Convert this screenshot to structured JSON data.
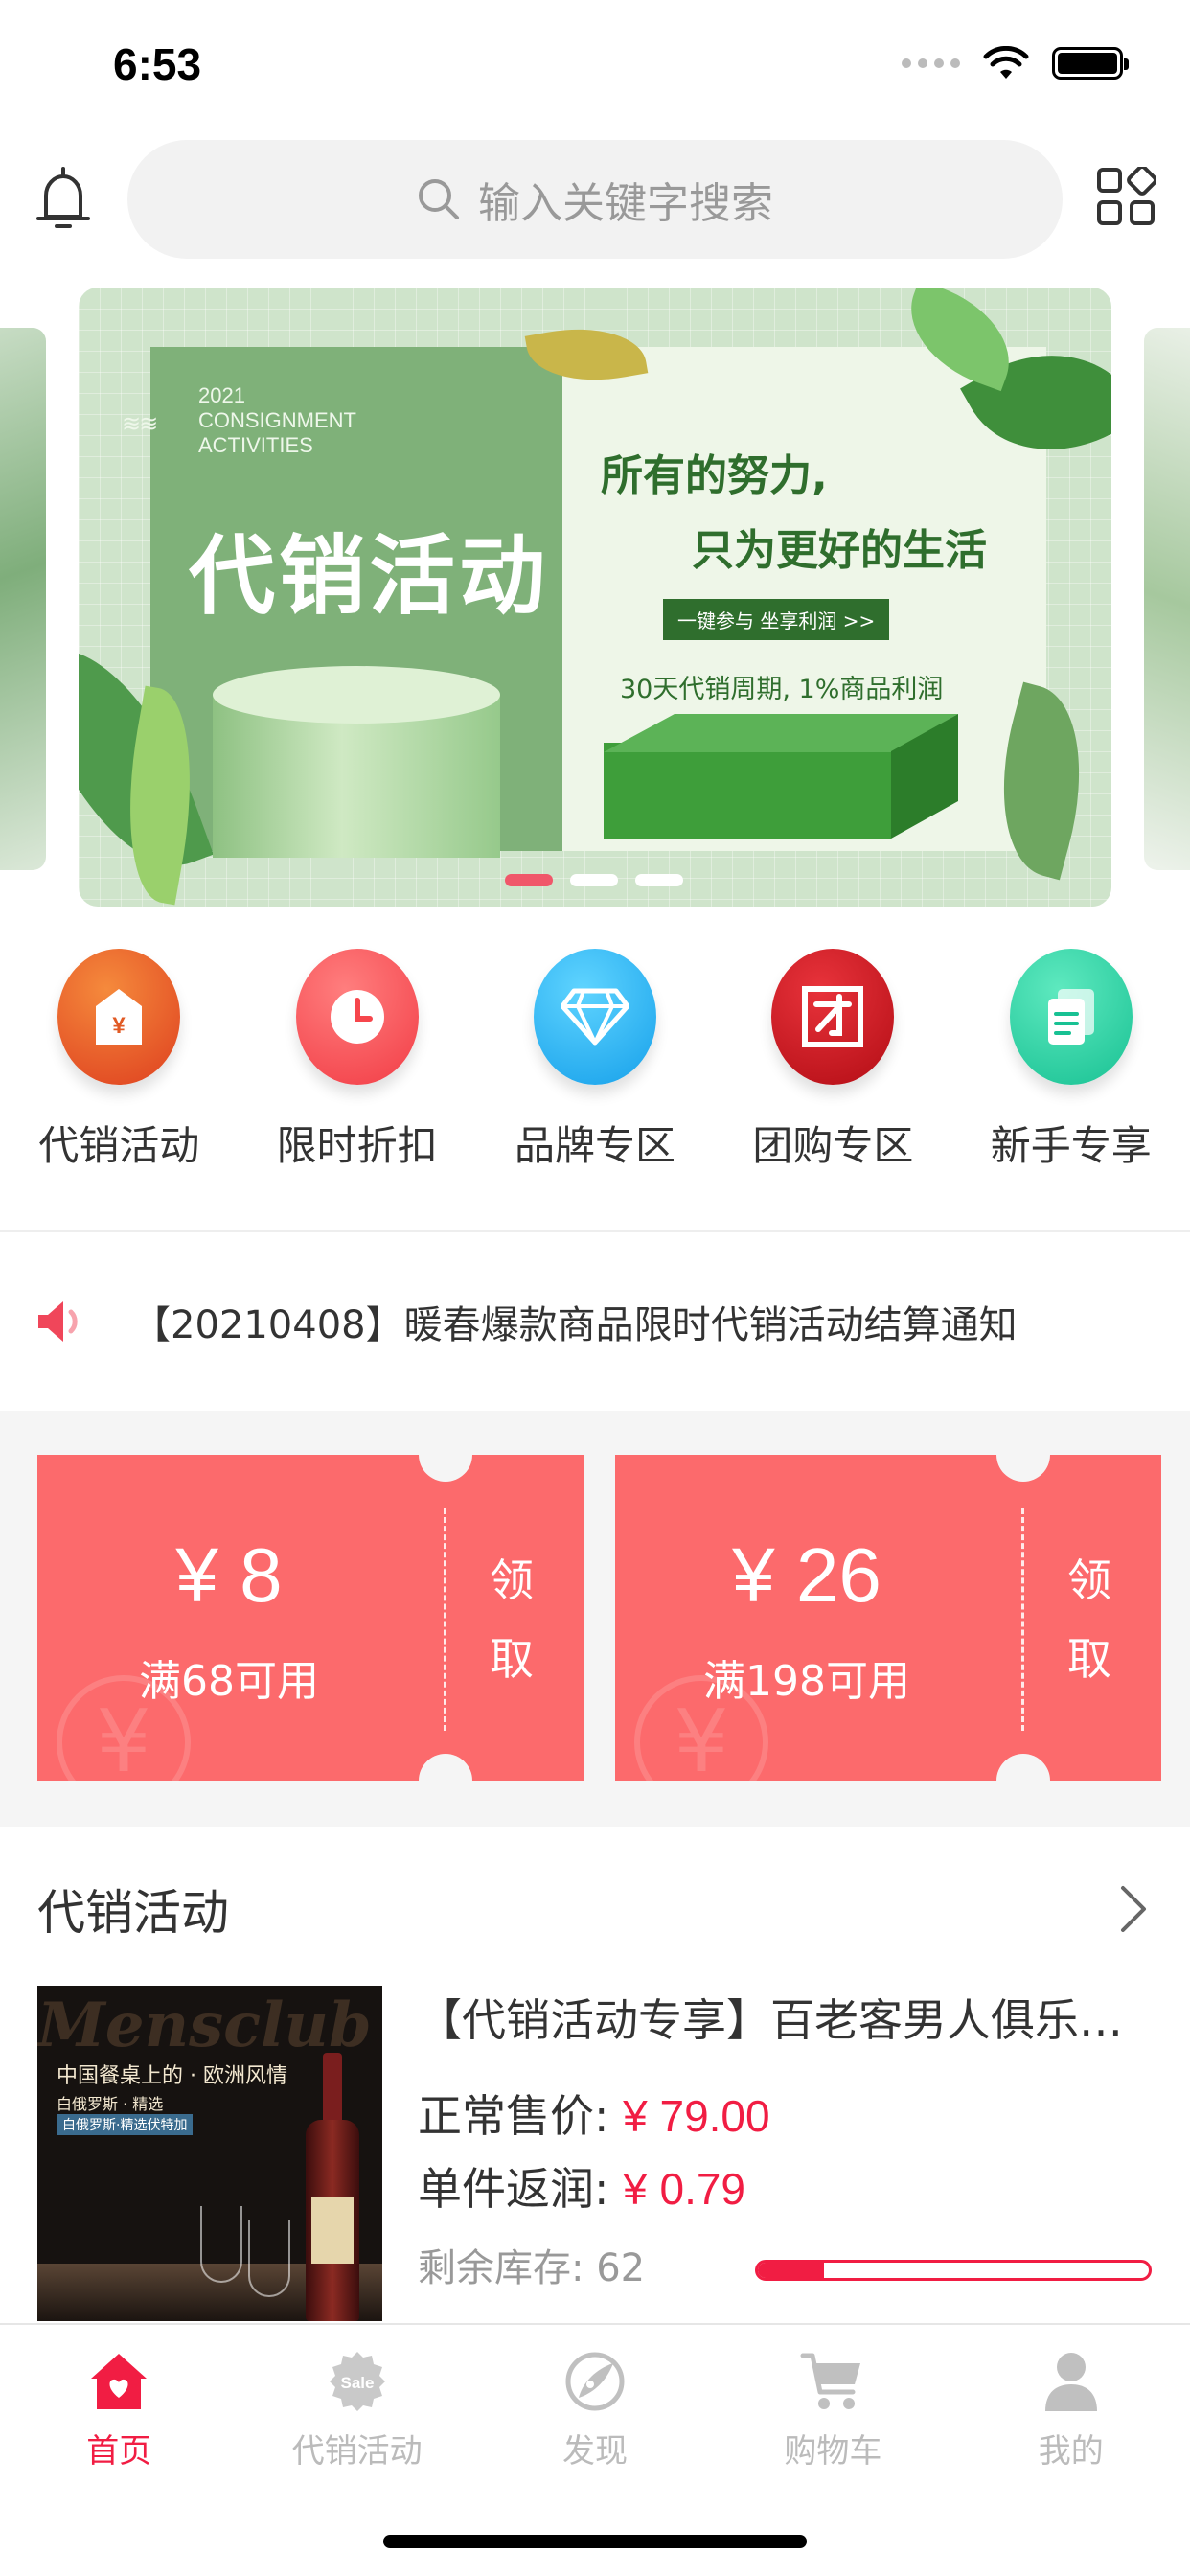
{
  "status_bar": {
    "time": "6:53"
  },
  "header": {
    "search_placeholder": "输入关键字搜索"
  },
  "banner": {
    "year_text": "2021",
    "en_line1": "CONSIGNMENT",
    "en_line2": "ACTIVITIES",
    "title": "代销活动",
    "line1": "所有的努力,",
    "line2": "只为更好的生活",
    "button": "一键参与 坐享利润 >>",
    "subline": "30天代销周期, 1%商品利润",
    "active_index": 0,
    "slides": 3
  },
  "categories": [
    {
      "label": "代销活动",
      "icon": "tag-icon",
      "color": "#e8672a"
    },
    {
      "label": "限时折扣",
      "icon": "clock-icon",
      "color": "#f6464c"
    },
    {
      "label": "品牌专区",
      "icon": "diamond-icon",
      "color": "#27b2f0"
    },
    {
      "label": "团购专区",
      "icon": "group-icon",
      "color": "#d4141c"
    },
    {
      "label": "新手专享",
      "icon": "document-icon",
      "color": "#2fd2a4"
    }
  ],
  "notice": {
    "text": "【20210408】暖春爆款商品限时代销活动结算通知"
  },
  "coupons": [
    {
      "amount": "¥ 8",
      "condition": "满68可用",
      "claim1": "领",
      "claim2": "取"
    },
    {
      "amount": "¥ 26",
      "condition": "满198可用",
      "claim1": "领",
      "claim2": "取"
    }
  ],
  "section": {
    "title": "代销活动"
  },
  "product": {
    "image_text": {
      "brand": "Mensclub",
      "tag1": "中国餐桌上的 · 欧洲风情",
      "tag2": "白俄罗斯 · 精选",
      "tag3": "白俄罗斯·精选伏特加"
    },
    "title": "【代销活动专享】百老客男人俱乐部伏特加",
    "price_label": "正常售价:",
    "price_value": "¥ 79.00",
    "rebate_label": "单件返润:",
    "rebate_value": "¥ 0.79",
    "stock_label": "剩余库存:",
    "stock_value": "62",
    "stock_progress": 0.17
  },
  "tabbar": [
    {
      "label": "首页",
      "icon": "home-icon",
      "active": true
    },
    {
      "label": "代销活动",
      "icon": "sale-icon",
      "active": false
    },
    {
      "label": "发现",
      "icon": "discover-icon",
      "active": false
    },
    {
      "label": "购物车",
      "icon": "cart-icon",
      "active": false
    },
    {
      "label": "我的",
      "icon": "profile-icon",
      "active": false
    }
  ],
  "colors": {
    "accent": "#f11d43",
    "coupon": "#fc6a6c",
    "inactive": "#bbbbbb"
  }
}
